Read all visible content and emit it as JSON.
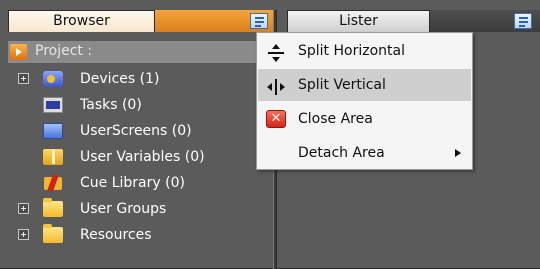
{
  "tabs": {
    "browser_label": "Browser",
    "lister_label": "Lister"
  },
  "project": {
    "label": "Project :"
  },
  "tree": {
    "items": [
      {
        "label": "Devices (1)",
        "icon": "devices-icon",
        "expandable": true
      },
      {
        "label": "Tasks (0)",
        "icon": "tasks-icon",
        "expandable": false
      },
      {
        "label": "UserScreens (0)",
        "icon": "user-screens-icon",
        "expandable": false
      },
      {
        "label": "User Variables (0)",
        "icon": "user-variables-icon",
        "expandable": false
      },
      {
        "label": "Cue Library (0)",
        "icon": "cue-library-icon",
        "expandable": false
      },
      {
        "label": "User Groups",
        "icon": "folder-icon",
        "expandable": true
      },
      {
        "label": "Resources",
        "icon": "folder-icon",
        "expandable": true
      }
    ]
  },
  "context_menu": {
    "items": [
      {
        "label": "Split Horizontal",
        "icon": "split-horizontal-icon"
      },
      {
        "label": "Split Vertical",
        "icon": "split-vertical-icon",
        "highlighted": true
      },
      {
        "label": "Close Area",
        "icon": "close-area-icon"
      },
      {
        "label": "Detach Area",
        "icon": "",
        "has_submenu": true
      }
    ]
  },
  "colors": {
    "panel_bg": "#5b5b5b",
    "tab_accent": "#f8a43a",
    "menu_bg": "#f5f5f5",
    "menu_highlight": "#cfcfcf"
  }
}
